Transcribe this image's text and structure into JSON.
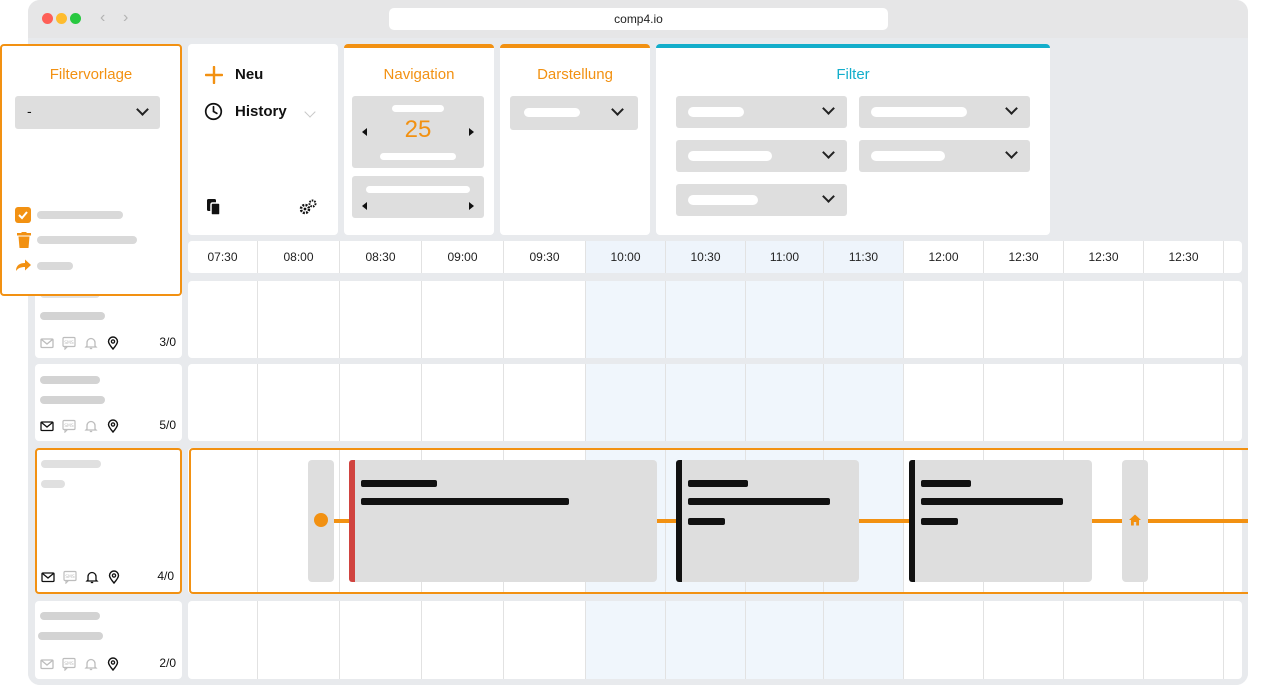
{
  "browser": {
    "url": "comp4.io"
  },
  "panels": {
    "filtervorlage": {
      "title": "Filtervorlage",
      "select_value": "-"
    },
    "actions": {
      "new_label": "Neu",
      "history_label": "History"
    },
    "navigation": {
      "title": "Navigation",
      "counter": "25"
    },
    "darstellung": {
      "title": "Darstellung"
    },
    "filter": {
      "title": "Filter"
    }
  },
  "timeline": {
    "slots": [
      "07:30",
      "08:00",
      "08:30",
      "09:00",
      "09:30",
      "10:00",
      "10:30",
      "11:00",
      "11:30",
      "12:00",
      "12:30",
      "12:30",
      "12:30"
    ],
    "highlighted_slots": [
      "10:00",
      "10:30",
      "11:00",
      "11:30"
    ]
  },
  "rows": [
    {
      "count": "3/0"
    },
    {
      "count": "5/0"
    },
    {
      "count": "4/0"
    },
    {
      "count": "2/0"
    }
  ],
  "colors": {
    "accent": "#f29112",
    "filter_accent": "#13aecb",
    "task_red": "#d0433f",
    "highlight_column": "#eef4fb"
  },
  "icons": [
    "plus-icon",
    "clock-icon",
    "copy-icon",
    "gears-icon",
    "checkbox-icon",
    "trash-icon",
    "share-icon",
    "mail-icon",
    "sms-icon",
    "bell-icon",
    "location-pin-icon",
    "home-icon"
  ]
}
